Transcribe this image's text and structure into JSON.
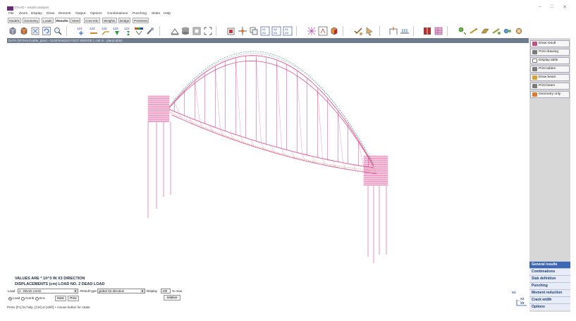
{
  "app": {
    "title": "STAAD - results analysis"
  },
  "menu": [
    "File",
    "Zoom",
    "Display",
    "Draw",
    "Element",
    "Output",
    "Options",
    "Combinations",
    "Punching",
    "Slabs",
    "Help"
  ],
  "tabs": [
    "Models",
    "Geometry",
    "Loads",
    "Results",
    "Steel",
    "Concrete",
    "Weights",
    "Bridge",
    "Prestress"
  ],
  "active_tab": "Results",
  "toolbar": {
    "result_icon_labels": [
      "123",
      "123",
      "123",
      "123",
      "123"
    ]
  },
  "document_title": "DATA (\\STRAU\\cable_plan) - SUSPENDED FOOT BRIDGE L=58 m - plan(cable)",
  "right_panel": {
    "buttons": [
      "Draw result",
      "Print drawing",
      "Display table",
      "Print tables",
      "Draw beam",
      "Print beam",
      "Geometry only"
    ],
    "tabs": [
      "General results",
      "Combinations",
      "Slab definition",
      "Punching",
      "Moment reduction",
      "Crack width",
      "Options"
    ],
    "active_tab": "General results"
  },
  "canvas": {
    "info_line1": "VALUES ARE * 10^3 IN X3 DIRECTION",
    "info_line2": "DISPLACEMENTS (cm)     LOAD NO. 2  DEAD LOAD"
  },
  "bottom": {
    "load_label": "Load",
    "load_value": "2 : DEAD LOAD",
    "result_type_label": "Result type",
    "result_type_value": "global X3 direction",
    "display_label": "Display",
    "display_value": "100",
    "display_unit": "% max",
    "radios": [
      "Load",
      "Comb",
      "Env"
    ],
    "next_label": "Next",
    "prev_label": "Prev",
    "relative_label": "relative",
    "axis_x": "X1",
    "axis_y": "X3",
    "axis_z": "X2"
  },
  "status": "Press [F1] for help, [Ctrl] or [shift] + mouse button for rotate"
}
